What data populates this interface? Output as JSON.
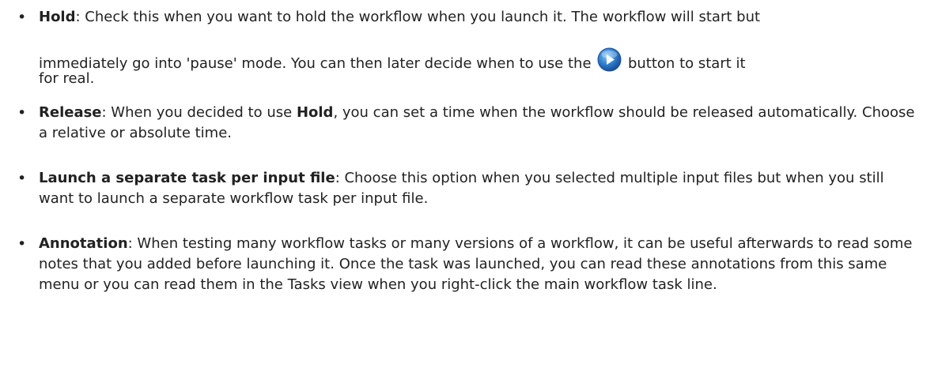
{
  "bullet_char": "•",
  "items": [
    {
      "term": "Hold",
      "line1": ": Check this when you want to hold the workflow when you launch it. The workflow will start but",
      "line2_before_icon": "immediately go into 'pause' mode. You can then later decide when to use the ",
      "line2_after_icon": " button to start it",
      "line3": "for real.",
      "icon": "play-button-icon",
      "icon_color": "#2f7fd1"
    },
    {
      "term": "Release",
      "text_a": ": When you decided to use ",
      "term_inline": "Hold",
      "text_b": ", you can set a time when the workflow should be released automatically. Choose a relative or absolute time."
    },
    {
      "term": "Launch a separate task per input file",
      "text": ": Choose this option when you selected multiple input files but when you still want to launch a separate workflow task per input file."
    },
    {
      "term": "Annotation",
      "text": ": When testing many workflow tasks or many versions of a workflow, it can be useful afterwards to read some notes that you added before launching it. Once the task was launched, you can read these annotations from this same menu or you can read them in the Tasks view when you right-click the main workflow task line."
    }
  ]
}
